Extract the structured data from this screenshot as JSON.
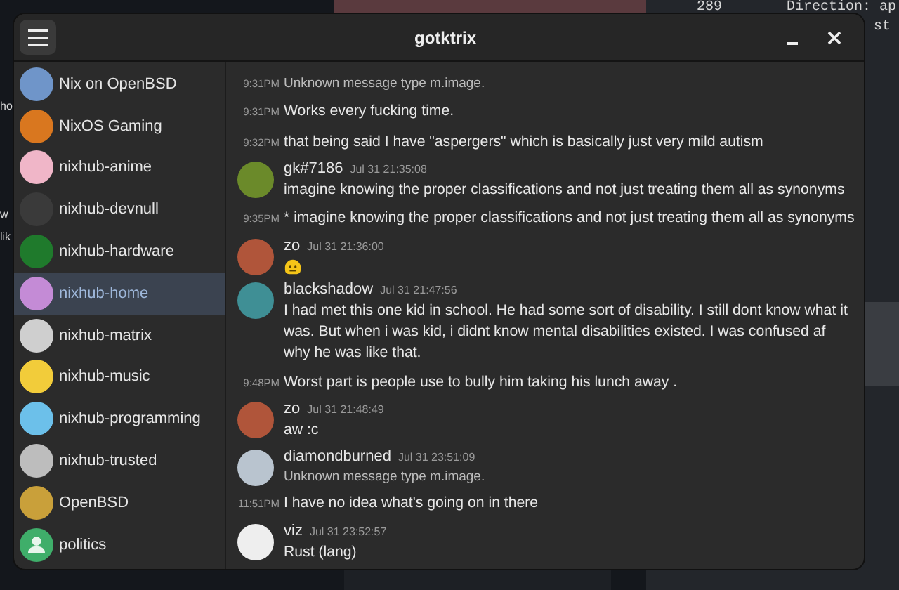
{
  "background_texts": [
    "289",
    "Direction: ap",
    "st",
    "ho",
    "w",
    "lik"
  ],
  "window": {
    "title": "gotktrix"
  },
  "rooms": [
    {
      "name": "Nix on OpenBSD",
      "selected": false,
      "kind": "image",
      "color": "#6f95c9"
    },
    {
      "name": "NixOS Gaming",
      "selected": false,
      "kind": "image",
      "color": "#d9771f"
    },
    {
      "name": "nixhub-anime",
      "selected": false,
      "kind": "image",
      "color": "#f0b6c8"
    },
    {
      "name": "nixhub-devnull",
      "selected": false,
      "kind": "image",
      "color": "#3a3a3a"
    },
    {
      "name": "nixhub-hardware",
      "selected": false,
      "kind": "image",
      "color": "#1f7a2c"
    },
    {
      "name": "nixhub-home",
      "selected": true,
      "kind": "image",
      "color": "#c48bd6"
    },
    {
      "name": "nixhub-matrix",
      "selected": false,
      "kind": "image",
      "color": "#cfcfcf"
    },
    {
      "name": "nixhub-music",
      "selected": false,
      "kind": "image",
      "color": "#f2cc3a"
    },
    {
      "name": "nixhub-programming",
      "selected": false,
      "kind": "image",
      "color": "#6cc0ea"
    },
    {
      "name": "nixhub-trusted",
      "selected": false,
      "kind": "image",
      "color": "#bdbdbd"
    },
    {
      "name": "OpenBSD",
      "selected": false,
      "kind": "image",
      "color": "#c9a03a"
    },
    {
      "name": "politics",
      "selected": false,
      "kind": "placeholder",
      "color": "#3fae6a"
    }
  ],
  "messages": [
    {
      "kind": "continuation",
      "time": "9:31PM",
      "body": "Unknown message type m.image.",
      "notice": true
    },
    {
      "kind": "continuation",
      "time": "9:31PM",
      "body": "Works every fucking time.",
      "notice": false
    },
    {
      "kind": "continuation",
      "time": "9:32PM",
      "body": "that being said I have \"aspergers\" which is basically just very mild autism",
      "notice": false
    },
    {
      "kind": "header",
      "sender": "gk#7186",
      "timestamp": "Jul 31 21:35:08",
      "color": "#6b8a2a",
      "body": "imagine knowing the proper classifications and not just treating them all as synonyms",
      "notice": false
    },
    {
      "kind": "continuation",
      "time": "9:35PM",
      "body": "* imagine knowing the proper classifications and not just treating them all as synonyms",
      "notice": false
    },
    {
      "kind": "header",
      "sender": "zo",
      "timestamp": "Jul 31 21:36:00",
      "color": "#b0553a",
      "emoji": true
    },
    {
      "kind": "header",
      "sender": "blackshadow",
      "timestamp": "Jul 31 21:47:56",
      "color": "#3f8f95",
      "body": "I had met this one kid in school. He had some sort of disability. I still dont know what it was. But when i was kid, i didnt know mental disabilities existed. I was confused af why he was like that.",
      "notice": false
    },
    {
      "kind": "continuation",
      "time": "9:48PM",
      "body": "Worst part is people use to bully him taking his lunch away .",
      "notice": false
    },
    {
      "kind": "header",
      "sender": "zo",
      "timestamp": "Jul 31 21:48:49",
      "color": "#b0553a",
      "body": "aw :c",
      "notice": false
    },
    {
      "kind": "header",
      "sender": "diamondburned",
      "timestamp": "Jul 31 23:51:09",
      "color": "#b9c4cf",
      "body": "Unknown message type m.image.",
      "notice": true
    },
    {
      "kind": "continuation",
      "time": "11:51PM",
      "body": "I have no idea what's going on in there",
      "notice": false
    },
    {
      "kind": "header",
      "sender": "viz",
      "timestamp": "Jul 31 23:52:57",
      "color": "#eeeeee",
      "body": "Rust (lang)",
      "notice": false
    }
  ]
}
